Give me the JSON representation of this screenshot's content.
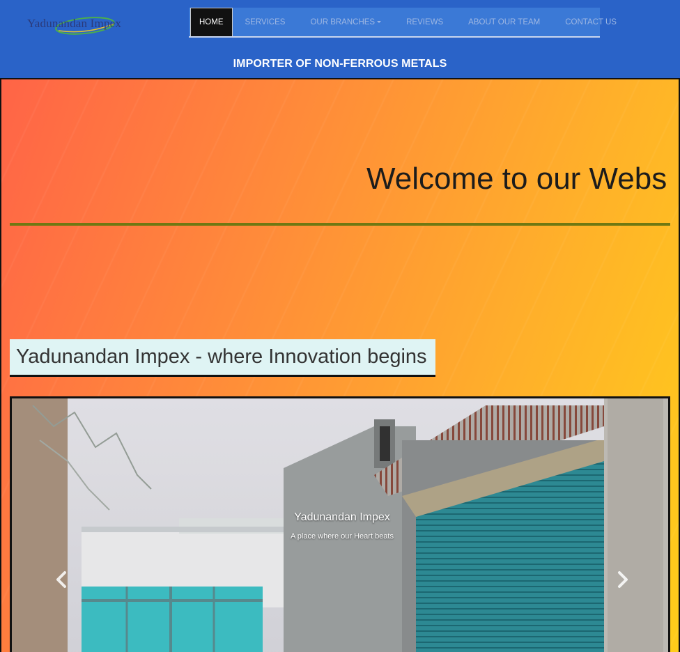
{
  "header": {
    "logo_text": "Yadunandan Impex",
    "tagline": "IMPORTER OF NON-FERROUS METALS"
  },
  "nav": {
    "items": [
      {
        "label": "HOME",
        "active": true
      },
      {
        "label": "SERVICES",
        "active": false
      },
      {
        "label": "OUR BRANCHES",
        "active": false,
        "dropdown": true
      },
      {
        "label": "REVIEWS",
        "active": false
      },
      {
        "label": "ABOUT OUR TEAM",
        "active": false
      },
      {
        "label": "CONTACT US",
        "active": false
      }
    ]
  },
  "hero": {
    "welcome": "Welcome to our Webs",
    "slogan": "Yadunandan Impex - where Innovation begins"
  },
  "carousel": {
    "caption_title": "Yadunandan Impex",
    "caption_sub": "A place where our Heart beats",
    "prev_icon": "chevron-left-icon",
    "next_icon": "chevron-right-icon"
  },
  "colors": {
    "header_bg": "#2a63c8",
    "nav_bg": "#3b79d6",
    "divider": "#6f7812",
    "slogan_bg": "#dff4f4"
  }
}
